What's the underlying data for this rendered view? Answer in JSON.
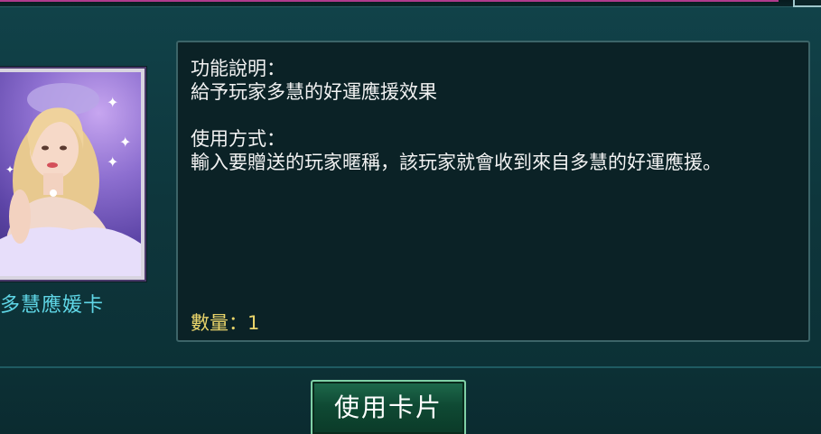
{
  "card": {
    "name": "多慧應媛卡",
    "image_icon": "portrait-image"
  },
  "description": {
    "function_heading": "功能說明：",
    "function_text": "給予玩家多慧的好運應援效果",
    "usage_heading": "使用方式：",
    "usage_text": "輸入要贈送的玩家暱稱，該玩家就會收到來自多慧的好運應援。",
    "quantity": "數量：1"
  },
  "button": {
    "use_card_label": "使用卡片"
  },
  "colors": {
    "card_name": "#5fd6e6",
    "quantity": "#e9d46a",
    "button_border": "#7fd0a6"
  }
}
